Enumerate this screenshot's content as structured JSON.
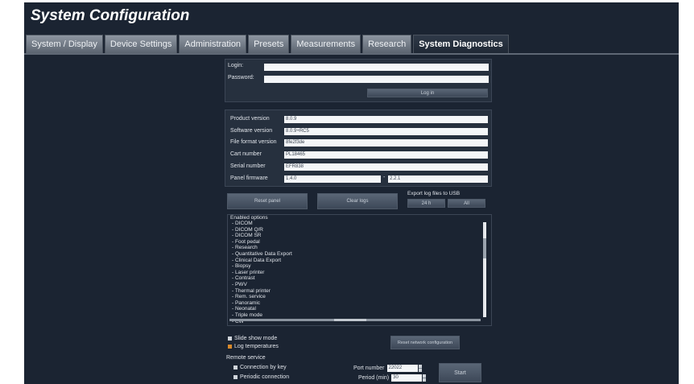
{
  "app": {
    "title": "System Configuration"
  },
  "tabs": [
    {
      "label": "System / Display"
    },
    {
      "label": "Device Settings"
    },
    {
      "label": "Administration"
    },
    {
      "label": "Presets"
    },
    {
      "label": "Measurements"
    },
    {
      "label": "Research"
    },
    {
      "label": "System Diagnostics",
      "active": true
    }
  ],
  "login": {
    "login_label": "Login:",
    "login_value": "",
    "password_label": "Password:",
    "password_value": "",
    "login_button": "Log in"
  },
  "info": {
    "product_version_label": "Product version",
    "product_version": "8.0.9",
    "software_version_label": "Software version",
    "software_version": "8.0.9+RC5",
    "file_format_version_label": "File format version",
    "file_format_version": "8fe2f3de",
    "cart_number_label": "Cart number",
    "cart_number": "PL18465",
    "serial_number_label": "Serial number",
    "serial_number": "EFR838",
    "panel_firmware_label": "Panel firmware",
    "panel_firmware": "1.4.0",
    "panel_firmware_2": "2.2.1"
  },
  "actions": {
    "reset_panel": "Reset panel",
    "clear_logs": "Clear logs",
    "export_logs_title": "Export log files to USB",
    "export_24h": "24 h",
    "export_all": "All"
  },
  "enabled_options": {
    "title": "Enabled options",
    "items": [
      "- DICOM",
      "- DICOM Q/R",
      "- DICOM SR",
      "- Foot pedal",
      "- Research",
      "- Quantitative Data Export",
      "- Clinical Data Export",
      "- Biopsy",
      "- Laser printer",
      "- Contrast",
      "- PWV",
      "- Thermal printer",
      "- Rem. service",
      "- Panoramic",
      "- Neonatal",
      "- Triple mode",
      "- CW"
    ]
  },
  "modes": {
    "slide_show": "Slide show mode",
    "log_temperatures": "Log temperatures",
    "reset_network": "Reset network configuration"
  },
  "remote_service": {
    "title": "Remote service",
    "connection_by_key": "Connection by key",
    "periodic_connection": "Periodic connection",
    "port_number_label": "Port number",
    "port_number": "22022",
    "period_label": "Period (min)",
    "period": "30",
    "start_button": "Start"
  }
}
